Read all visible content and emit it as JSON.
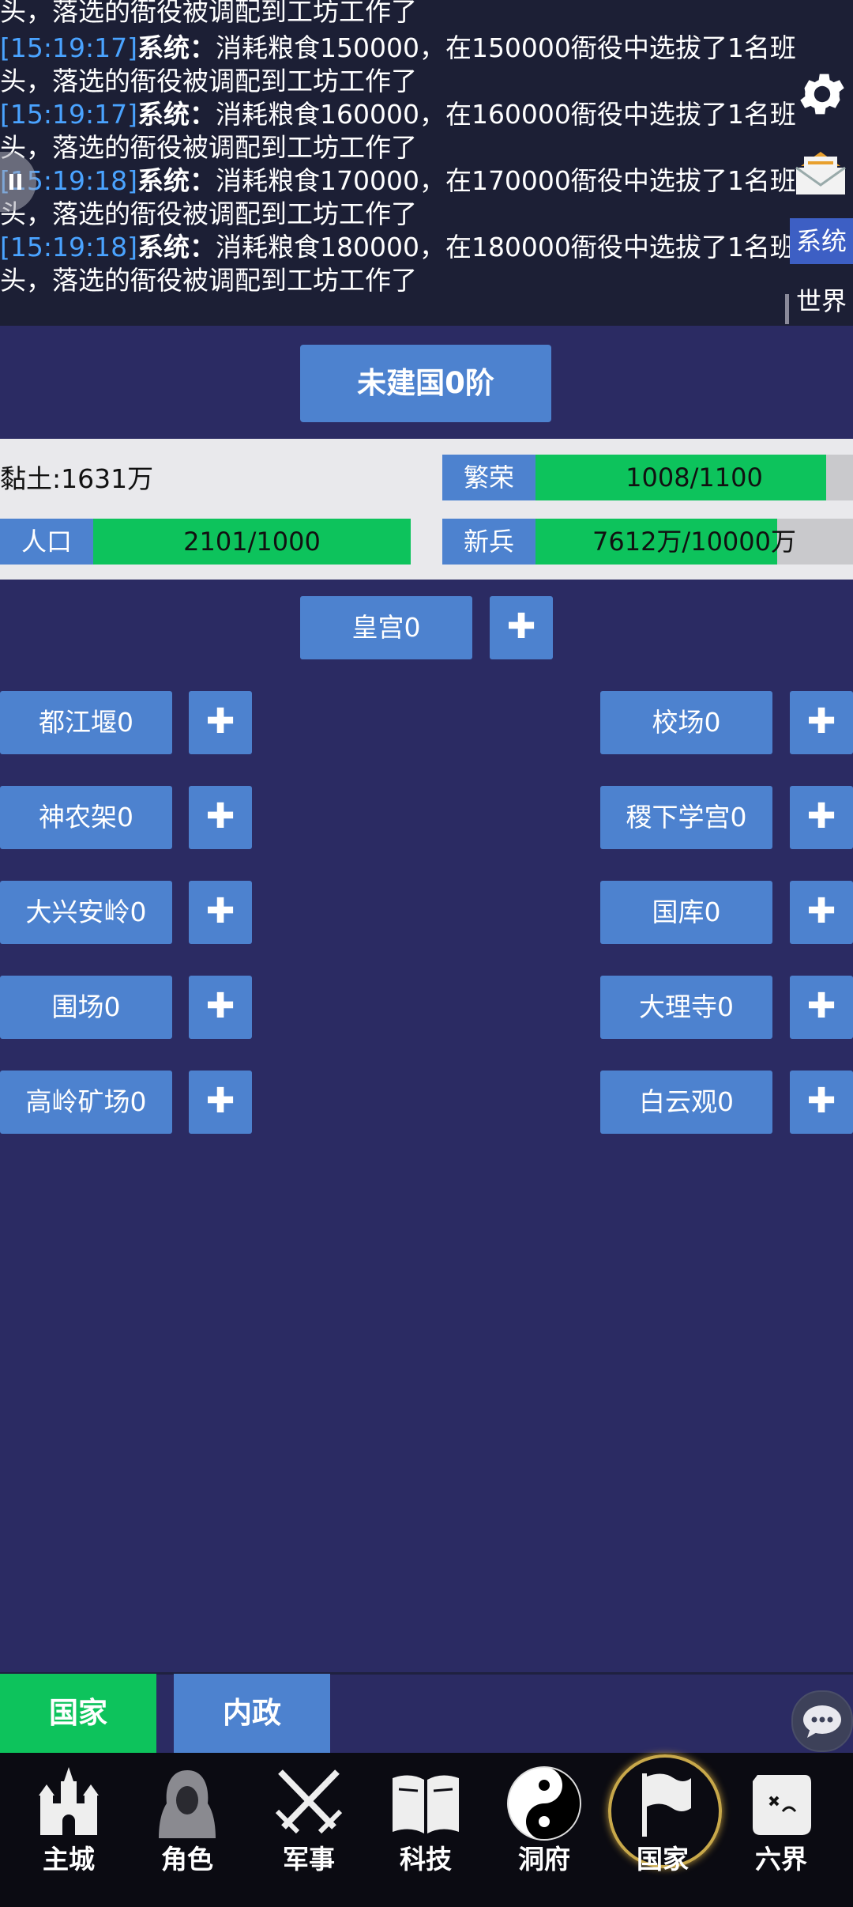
{
  "log": {
    "partial_line": "头，落选的衙役被调配到工坊工作了",
    "entries": [
      {
        "time": "[15:19:17]",
        "sender": "系统：",
        "text": "消耗粮食150000，在150000衙役中选拔了1名班",
        "cont": "头，落选的衙役被调配到工坊工作了"
      },
      {
        "time": "[15:19:17]",
        "sender": "系统：",
        "text": "消耗粮食160000，在160000衙役中选拔了1名班",
        "cont": "头，落选的衙役被调配到工坊工作了"
      },
      {
        "time": "[15:19:18]",
        "sender": "系统：",
        "text": "消耗粮食170000，在170000衙役中选拔了1名班",
        "cont": "头，落选的衙役被调配到工坊工作了"
      },
      {
        "time": "[15:19:18]",
        "sender": "系统：",
        "text": "消耗粮食180000，在180000衙役中选拔了1名班",
        "cont": "头，落选的衙役被调配到工坊工作了"
      }
    ],
    "tabs": {
      "system": "系统",
      "world": "世界"
    }
  },
  "nation": {
    "title": "未建国0阶"
  },
  "stats": {
    "clay": "黏土:1631万",
    "prosperity": {
      "label": "繁荣",
      "value": "1008/1100",
      "fill": 0.916
    },
    "population": {
      "label": "人口",
      "value": "2101/1000",
      "fill": 1.0
    },
    "recruits": {
      "label": "新兵",
      "value": "7612万/10000万",
      "fill": 0.7612
    }
  },
  "buildings": {
    "palace": "皇宫0",
    "left": [
      "都江堰0",
      "神农架0",
      "大兴安岭0",
      "围场0",
      "高岭矿场0"
    ],
    "right": [
      "校场0",
      "稷下学宫0",
      "国库0",
      "大理寺0",
      "白云观0"
    ],
    "plus_symbol": "✚"
  },
  "subtabs": {
    "nation": "国家",
    "domestic": "内政"
  },
  "nav": {
    "items": [
      {
        "label": "主城",
        "icon": "castle-icon"
      },
      {
        "label": "角色",
        "icon": "hooded-figure-icon"
      },
      {
        "label": "军事",
        "icon": "crossed-swords-icon"
      },
      {
        "label": "科技",
        "icon": "book-icon"
      },
      {
        "label": "洞府",
        "icon": "yin-yang-icon"
      },
      {
        "label": "国家",
        "icon": "flag-icon"
      },
      {
        "label": "六界",
        "icon": "scroll-map-icon"
      }
    ],
    "active": "国家",
    "accent": "#c8a84a"
  },
  "colors": {
    "button": "#4d82cf",
    "green": "#0dc35c",
    "background": "#2b2b63",
    "timestamp": "#4aa3ff"
  }
}
